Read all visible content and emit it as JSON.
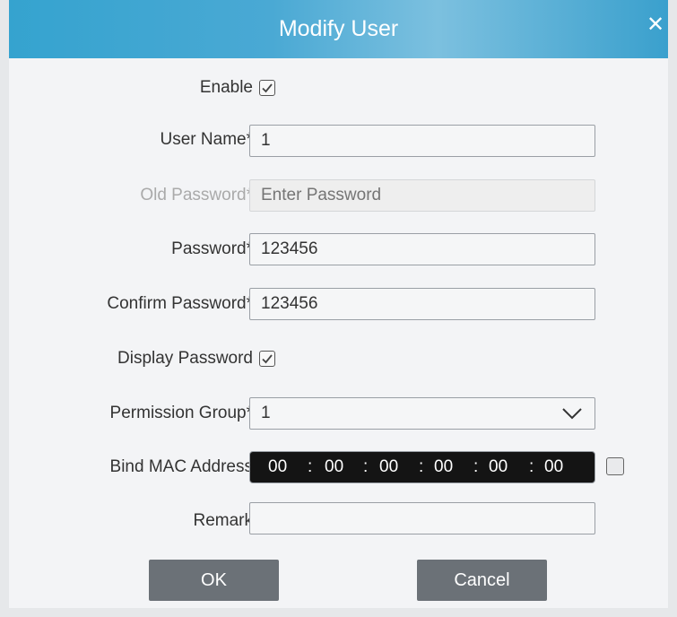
{
  "dialog": {
    "title": "Modify User",
    "close_symbol": "✕"
  },
  "form": {
    "enable": {
      "label": "Enable",
      "checked": true
    },
    "user_name": {
      "label": "User Name*",
      "value": "1"
    },
    "old_password": {
      "label": "Old Password*",
      "placeholder": "Enter Password",
      "value": ""
    },
    "password": {
      "label": "Password*",
      "value": "123456"
    },
    "confirm_password": {
      "label": "Confirm Password*",
      "value": "123456"
    },
    "display_password": {
      "label": "Display Password",
      "checked": true
    },
    "permission_group": {
      "label": "Permission Group*",
      "value": "1"
    },
    "bind_mac": {
      "label": "Bind MAC Address",
      "octets": [
        "00",
        "00",
        "00",
        "00",
        "00",
        "00"
      ],
      "separator": ":",
      "checked": false
    },
    "remark": {
      "label": "Remark",
      "value": ""
    }
  },
  "buttons": {
    "ok": "OK",
    "cancel": "Cancel"
  },
  "icons": {
    "close": "close-icon",
    "check": "check-icon",
    "dropdown": "chevron-down-icon"
  },
  "colors": {
    "titlebar": "#3aa3cf",
    "button": "#6b7177",
    "mac_field": "#141414"
  }
}
